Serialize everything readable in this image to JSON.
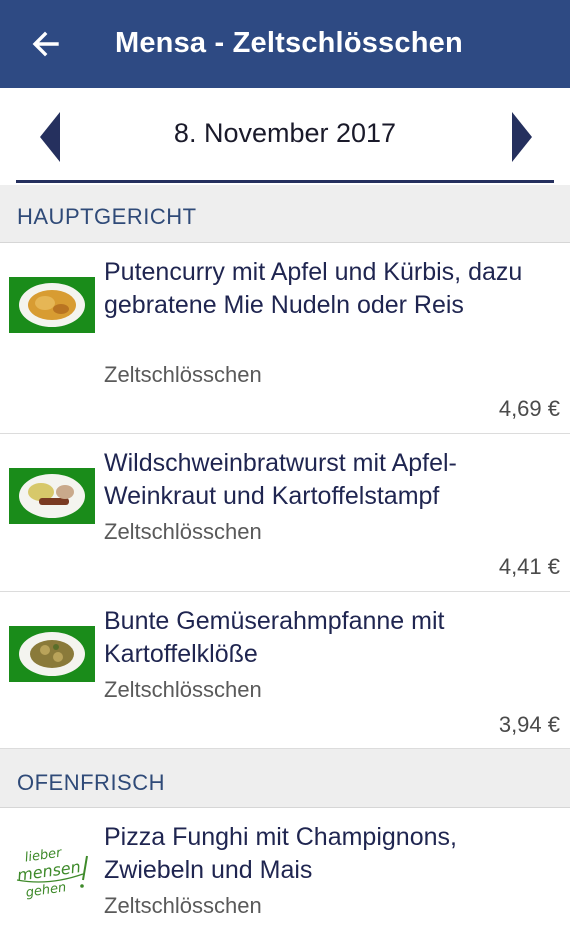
{
  "appbar": {
    "title": "Mensa - Zeltschlösschen",
    "back_icon": "arrow-left-icon"
  },
  "datebar": {
    "date": "8. November 2017",
    "prev_icon": "triangle-left-icon",
    "next_icon": "triangle-right-icon"
  },
  "sections": [
    {
      "label": "HAUPTGERICHT",
      "meals": [
        {
          "title": "Putencurry mit Apfel und Kürbis, dazu gebratene Mie Nudeln oder Reis",
          "location": "Zeltschlösschen",
          "price": "4,69 €"
        },
        {
          "title": "Wildschweinbratwurst mit Apfel-Weinkraut und Kartoffelstampf",
          "location": "Zeltschlösschen",
          "price": "4,41 €"
        },
        {
          "title": "Bunte Gemüserahmpfanne mit Kartoffelklöße",
          "location": "Zeltschlösschen",
          "price": "3,94 €"
        }
      ]
    },
    {
      "label": "OFENFRISCH",
      "meals": [
        {
          "title": "Pizza Funghi mit Champignons, Zwiebeln und Mais",
          "location": "Zeltschlösschen",
          "logo_text": [
            "lieber",
            "mensen",
            "gehen"
          ]
        }
      ]
    }
  ],
  "colors": {
    "appbar": "#2e4a83",
    "section_text": "#2f4a78",
    "meal_title": "#1f2550",
    "thumb_green": "#1a8c1a"
  }
}
